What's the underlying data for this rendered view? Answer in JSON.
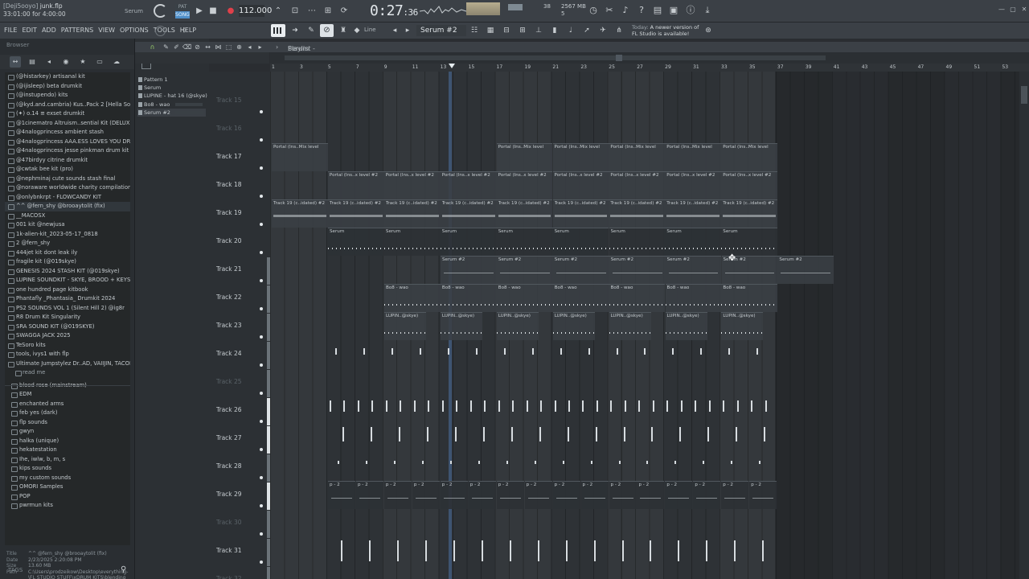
{
  "topbar": {
    "project_user": "[Deji5ooyo]",
    "project_file": "junk.flp",
    "song_pos": "33:01:00 for 4:00:00",
    "channel_label": "Serum",
    "song_toggle_top": "PAT",
    "song_toggle_bottom": "SONG",
    "bpm": "112.000",
    "time_main": "0:27",
    "time_sub": ":36",
    "poly": "38",
    "mem_mb": "2567 MB",
    "mem_sub": "5"
  },
  "menu": {
    "items": [
      "FILE",
      "EDIT",
      "ADD",
      "PATTERNS",
      "VIEW",
      "OPTIONS",
      "TOOLS",
      "HELP"
    ]
  },
  "toolbar2": {
    "line_label": "Line",
    "pattern_select": "Serum #2",
    "news_today": "Today",
    "news_line1": "A newer version of",
    "news_line2": "FL Studio is available!"
  },
  "browser": {
    "header": "Browser",
    "items": [
      "(@histarkey) artisanal kit",
      "(@ijisleep) beta drumkit",
      "(@instupendo) kits",
      "(@kyd.and.cambria) Kus..Pack 2 [Hella Sounds]",
      "(✦) o.14 ≡ exset drumkit",
      "@1cinematro Altruism..sential Kit (DELUXE) ∑∑",
      "@4nalogprincess ambient stash",
      "@4nalogprincess AAA.ESS LOVES YOU DRUMKIT",
      "@4nalogprincess jesse pinkman drum kit",
      "@47birdyy citrine drumkit",
      "@cwtak bee kit (pro)",
      "@nephminaj cute sounds stash final",
      "@noraware worldwide charity compilation",
      "@onlybnkrpt - FLOWCANDY KIT",
      "^^ @fern_shy @brooaytolit (fix)",
      "__MACOSX",
      "001 kit @newjusa",
      "1k-alien-kit_2023-05-17_0818",
      "2 @fern_shy",
      "444jet kit dont leak ily",
      "fragile kit (@019skye)",
      "GENESIS 2024 STASH KIT (@019skye)",
      "LUPINE SOUNDKIT - SKYE, BROOD + KEYS",
      "one hundred page kitbook",
      "Phantafly _Phantasia_ Drumkit 2024",
      "PS2 SOUNDS VOL 1 (Silent Hill 2) @ig8r",
      "R8 Drum Kit Singularity",
      "SRA SOUND KIT (@019SKYE)",
      "SWAGGA JACK 2025",
      "TeSoro kits",
      "tools, ivys1 with flp",
      "Ultimate Jumpstylez Dr..AD, VAIIJIN, TACONIE)",
      "read me",
      "blood rose (mainstream)",
      "EDM",
      "enchanted arms",
      "feb yes (dark)",
      "flp sounds",
      "gwyn",
      "halka (unique)",
      "hekatestation",
      "Ihe, iwlw, b, m, s",
      "kips sounds",
      "my custom sounds",
      "OMORI Samples",
      "POP",
      "pwrmun kits"
    ],
    "info": {
      "title_k": "Title",
      "title_v": "^^ @fern_shy @brooaytolit (fix)",
      "date_k": "Date",
      "date_v": "2/23/2025 2:20:08 PM",
      "size_k": "Size",
      "size_v": "13.60 MB",
      "path_k": "Path",
      "path_v": "C:\\Users\\prodzeikow\\Desktop\\everything-\\FL STUDIO STUFF\\xDRUM KITS\\blending heart drew (organic) ^^ @fern_shy @brooaytolit (fix)"
    },
    "tags_label": "TAGS"
  },
  "picker": {
    "items": [
      "Pattern 1",
      "Serum",
      "LUPINE - hat 16 (@skye)",
      "Bo8 - wao",
      "Serum #2"
    ]
  },
  "playlist": {
    "title": "Playlist - Arrangement",
    "crumb": "Serum #2",
    "ruler": [
      "1",
      "3",
      "5",
      "7",
      "9",
      "11",
      "13",
      "15",
      "17",
      "19",
      "21",
      "23",
      "25",
      "27",
      "29",
      "31",
      "33",
      "35",
      "37",
      "39",
      "41",
      "43",
      "45",
      "47",
      "49",
      "51",
      "53"
    ],
    "tracks": [
      {
        "name": "Track 15",
        "dim": true
      },
      {
        "name": "Track 16",
        "dim": true
      },
      {
        "name": "Track 17",
        "dim": false
      },
      {
        "name": "Track 18",
        "dim": false
      },
      {
        "name": "Track 19",
        "dim": false
      },
      {
        "name": "Track 20",
        "dim": false
      },
      {
        "name": "Track 21",
        "dim": false
      },
      {
        "name": "Track 22",
        "dim": false
      },
      {
        "name": "Track 23",
        "dim": false
      },
      {
        "name": "Track 24",
        "dim": false
      },
      {
        "name": "Track 25",
        "dim": true
      },
      {
        "name": "Track 26",
        "dim": false
      },
      {
        "name": "Track 27",
        "dim": false
      },
      {
        "name": "Track 28",
        "dim": false
      },
      {
        "name": "Track 29",
        "dim": false
      },
      {
        "name": "Track 30",
        "dim": true
      },
      {
        "name": "Track 31",
        "dim": false
      },
      {
        "name": "Track 32",
        "dim": true
      }
    ],
    "clip_labels": {
      "portal_mix": "Portal (Ins..Mix level",
      "portal_x2": "Portal (Ins..x level #2",
      "track19": "Track 19 (c..idated) #2",
      "serum": "Serum",
      "serum2": "Serum #2",
      "bo8": "Bo8 - wao",
      "lupin": "LUPIN..@skye)",
      "p2": "p - 2"
    }
  }
}
